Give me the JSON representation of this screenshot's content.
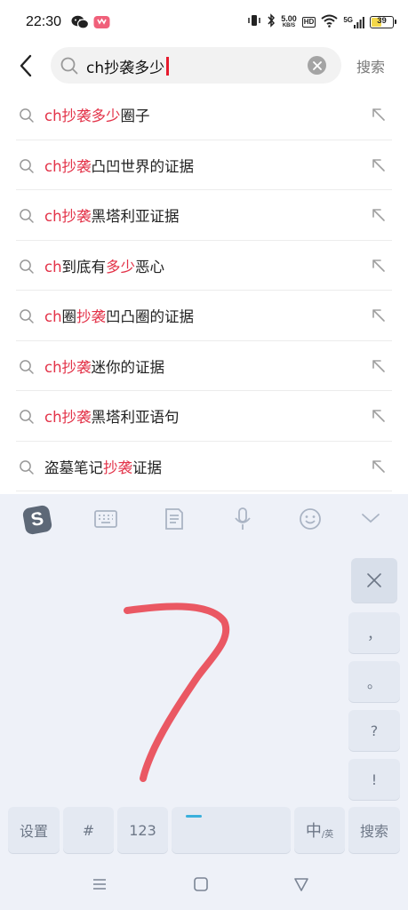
{
  "status": {
    "time": "22:30",
    "net_speed": "5.00",
    "net_unit": "KB/S",
    "hd": "HD",
    "signal": "5G",
    "battery": "39"
  },
  "search": {
    "query": "ch抄袭多少",
    "button": "搜索"
  },
  "suggestions": [
    [
      {
        "t": "ch抄袭多少",
        "h": true
      },
      {
        "t": "圈子",
        "h": false
      }
    ],
    [
      {
        "t": "ch抄袭",
        "h": true
      },
      {
        "t": "凸凹世界的证据",
        "h": false
      }
    ],
    [
      {
        "t": "ch抄袭",
        "h": true
      },
      {
        "t": "黑塔利亚证据",
        "h": false
      }
    ],
    [
      {
        "t": "ch",
        "h": true
      },
      {
        "t": "到底有",
        "h": false
      },
      {
        "t": "多少",
        "h": true
      },
      {
        "t": "恶心",
        "h": false
      }
    ],
    [
      {
        "t": "ch",
        "h": true
      },
      {
        "t": "圈",
        "h": false
      },
      {
        "t": "抄袭",
        "h": true
      },
      {
        "t": "凹凸圈的证据",
        "h": false
      }
    ],
    [
      {
        "t": "ch抄袭",
        "h": true
      },
      {
        "t": "迷你的证据",
        "h": false
      }
    ],
    [
      {
        "t": "ch抄袭",
        "h": true
      },
      {
        "t": "黑塔利亚语句",
        "h": false
      }
    ],
    [
      {
        "t": "盗墓笔记",
        "h": false
      },
      {
        "t": "抄袭",
        "h": true
      },
      {
        "t": "证据",
        "h": false
      }
    ]
  ],
  "keyboard": {
    "logo": "S",
    "side_keys": [
      "，",
      "。",
      "?",
      "!"
    ],
    "bottom": {
      "settings": "设置",
      "hash": "#",
      "num": "123",
      "lang_main": "中",
      "lang_sub": "/英",
      "search": "搜索"
    }
  },
  "colors": {
    "highlight": "#e33248",
    "ink": "#e8505f",
    "keyboard_bg": "#eef1f8"
  }
}
